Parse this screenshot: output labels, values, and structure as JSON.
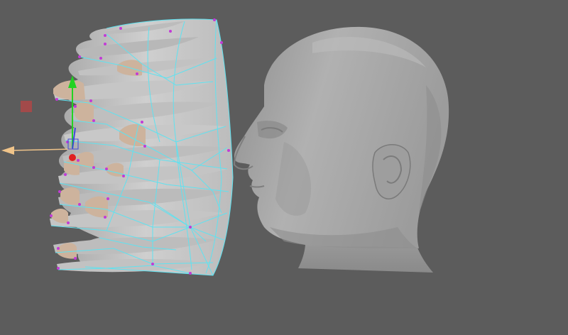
{
  "viewport": {
    "background_color": "#5c5c5c"
  },
  "scene": {
    "head_mesh": {
      "fill_color": "#a9a9a9",
      "shade_color": "#8e8e8e",
      "highlight_color": "#bdbdbd"
    },
    "hair_mesh": {
      "fill_color": "#c6c6c6",
      "shade_color": "#9b9b9b",
      "tip_color": "#cdb39d",
      "wireframe_color": "#5fe2f0",
      "vertex_color": "#c23bd6"
    }
  },
  "manipulator": {
    "y_axis_color": "#22d322",
    "x_axis_color": "#f0c48a",
    "z_axis_color": "#3f49d9",
    "pivot_color": "#e02020",
    "proxy_marker_color": "#a24a4a"
  }
}
